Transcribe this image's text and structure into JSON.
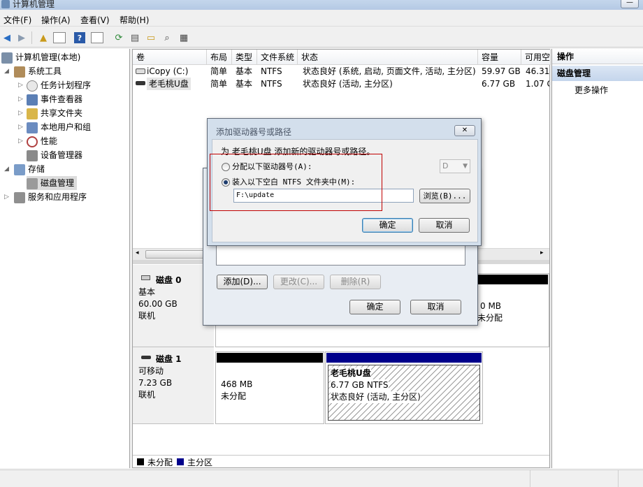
{
  "window": {
    "title": "计算机管理",
    "min_btn": "—"
  },
  "menu": [
    "文件(F)",
    "操作(A)",
    "查看(V)",
    "帮助(H)"
  ],
  "tree": {
    "root": "计算机管理(本地)",
    "system_tools": "系统工具",
    "task_scheduler": "任务计划程序",
    "event_viewer": "事件查看器",
    "shared_folders": "共享文件夹",
    "local_users": "本地用户和组",
    "performance": "性能",
    "device_manager": "设备管理器",
    "storage": "存储",
    "disk_management": "磁盘管理",
    "services": "服务和应用程序"
  },
  "volume_table": {
    "headers": [
      "卷",
      "布局",
      "类型",
      "文件系统",
      "状态",
      "容量",
      "可用空"
    ],
    "rows": [
      [
        "iCopy (C:)",
        "简单",
        "基本",
        "NTFS",
        "状态良好 (系统, 启动, 页面文件, 活动, 主分区)",
        "59.97 GB",
        "46.31"
      ],
      [
        "老毛桃U盘",
        "简单",
        "基本",
        "NTFS",
        "状态良好 (活动, 主分区)",
        "6.77 GB",
        "1.07 G"
      ]
    ]
  },
  "disk0": {
    "name": "磁盘 0",
    "type": "基本",
    "size": "60.00 GB",
    "status": "联机",
    "right_size": "0 MB",
    "right_status": "未分配"
  },
  "disk1": {
    "name": "磁盘 1",
    "type": "可移动",
    "size": "7.23 GB",
    "status": "联机",
    "unalloc_size": "468 MB",
    "unalloc_label": "未分配",
    "vol_name": "老毛桃U盘",
    "vol_size": "6.77 GB NTFS",
    "vol_status": "状态良好 (活动, 主分区)"
  },
  "legend": {
    "unallocated": "未分配",
    "primary": "主分区"
  },
  "actions_pane": {
    "header": "操作",
    "section": "磁盘管理",
    "more": "更多操作"
  },
  "outer_dialog": {
    "add": "添加(D)...",
    "change": "更改(C)...",
    "remove": "删除(R)",
    "ok": "确定",
    "cancel": "取消"
  },
  "dialog": {
    "title": "添加驱动器号或路径",
    "close": "✕",
    "prompt": "为 老毛桃U盘 添加新的驱动器号或路径。",
    "option_letter": "分配以下驱动器号(A):",
    "letter_value": "D",
    "option_folder": "装入以下空白 NTFS 文件夹中(M):",
    "path_value": "F:\\update",
    "browse": "浏览(B)...",
    "ok": "确定",
    "cancel": "取消"
  },
  "colors": {
    "unallocated": "#000000",
    "primary": "#00008b",
    "highlight": "#c00000"
  }
}
